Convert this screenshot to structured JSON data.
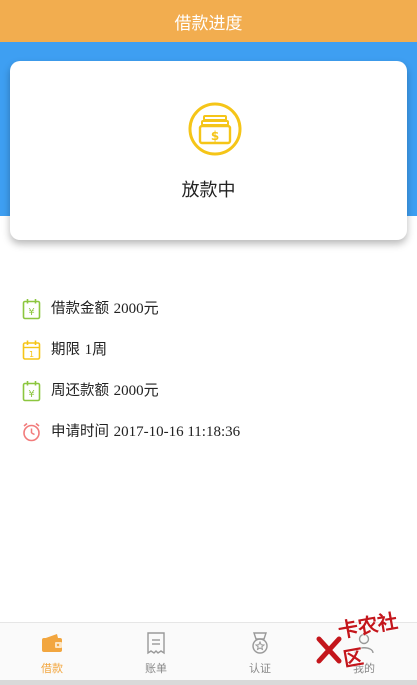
{
  "header": {
    "title": "借款进度"
  },
  "card": {
    "status": "放款中",
    "icon": "money-box-icon"
  },
  "info": {
    "amount": {
      "label": "借款金额",
      "value": "2000元",
      "icon": "yuan-calendar-icon"
    },
    "term": {
      "label": "期限",
      "value": "1周",
      "icon": "calendar-icon"
    },
    "weekly_repay": {
      "label": "周还款额",
      "value": "2000元",
      "icon": "yuan-calendar-icon"
    },
    "apply_time": {
      "label": "申请时间",
      "value": "2017-10-16 11:18:36",
      "icon": "alarm-clock-icon"
    }
  },
  "tabs": [
    {
      "label": "借款",
      "icon": "wallet-icon",
      "active": true
    },
    {
      "label": "账单",
      "icon": "bill-icon",
      "active": false
    },
    {
      "label": "认证",
      "icon": "badge-icon",
      "active": false
    },
    {
      "label": "我的",
      "icon": "user-icon",
      "active": false
    }
  ],
  "watermark": {
    "text": "卡农社区"
  },
  "colors": {
    "header_bg": "#f2ad4f",
    "band_bg": "#3e9ff2",
    "accent": "#f5c518",
    "active_tab": "#f2a63f"
  }
}
